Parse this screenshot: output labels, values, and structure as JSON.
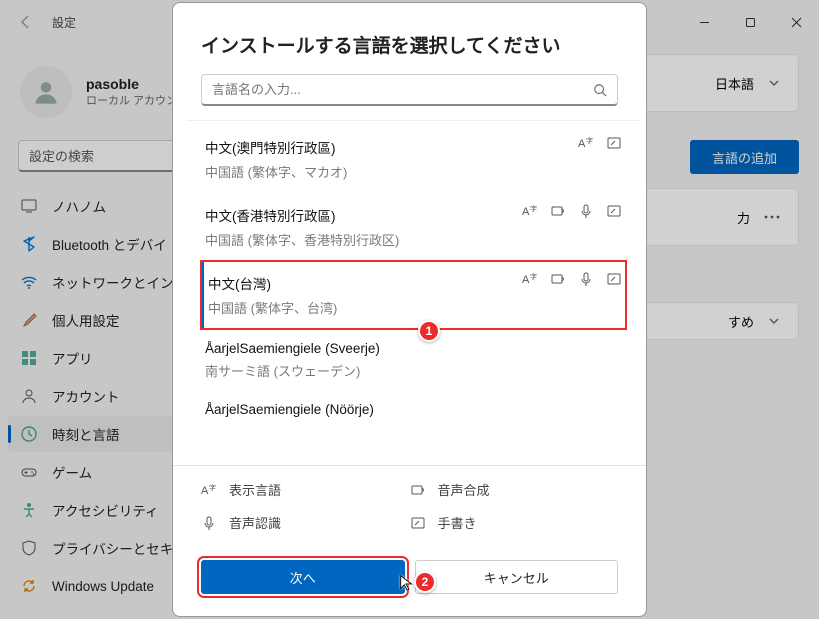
{
  "titlebar": {
    "title": "設定"
  },
  "profile": {
    "name": "pasoble",
    "sub": "ローカル アカウン"
  },
  "search": {
    "placeholder": "設定の検索"
  },
  "nav": [
    {
      "label": "ノハノム",
      "icon": "system"
    },
    {
      "label": "Bluetooth とデバイ",
      "icon": "bluetooth"
    },
    {
      "label": "ネットワークとインタ",
      "icon": "wifi"
    },
    {
      "label": "個人用設定",
      "icon": "brush"
    },
    {
      "label": "アプリ",
      "icon": "apps"
    },
    {
      "label": "アカウント",
      "icon": "person"
    },
    {
      "label": "時刻と言語",
      "icon": "clock",
      "active": true
    },
    {
      "label": "ゲーム",
      "icon": "game"
    },
    {
      "label": "アクセシビリティ",
      "icon": "access"
    },
    {
      "label": "プライバシーとセキ",
      "icon": "shield"
    },
    {
      "label": "Windows Update",
      "icon": "update"
    }
  ],
  "content": {
    "lang_value": "日本語",
    "add_button": "言語の追加",
    "input_hint": "力",
    "recommend": "すめ"
  },
  "dialog": {
    "title": "インストールする言語を選択してください",
    "search_placeholder": "言語名の入力...",
    "languages": [
      {
        "title": "中文(澳門特別行政區)",
        "sub": "中国語 (繁体字、マカオ)",
        "feats": [
          "disp",
          "hand"
        ]
      },
      {
        "title": "中文(香港特別行政區)",
        "sub": "中国語 (繁体字、香港特別行政区)",
        "feats": [
          "disp",
          "tts",
          "voice",
          "hand"
        ]
      },
      {
        "title": "中文(台灣)",
        "sub": "中国語 (繁体字、台湾)",
        "feats": [
          "disp",
          "tts",
          "voice",
          "hand"
        ],
        "selected": true
      },
      {
        "title": "ÅarjelSaemiengiele (Sveerje)",
        "sub": "南サーミ語 (スウェーデン)",
        "feats": []
      },
      {
        "title": "ÅarjelSaemiengiele (Nöörje)",
        "sub": "",
        "feats": [],
        "cut": true
      }
    ],
    "legend": {
      "display": "表示言語",
      "tts": "音声合成",
      "voice": "音声認識",
      "hand": "手書き"
    },
    "buttons": {
      "next": "次へ",
      "cancel": "キャンセル"
    }
  },
  "callouts": {
    "c1": "1",
    "c2": "2"
  }
}
